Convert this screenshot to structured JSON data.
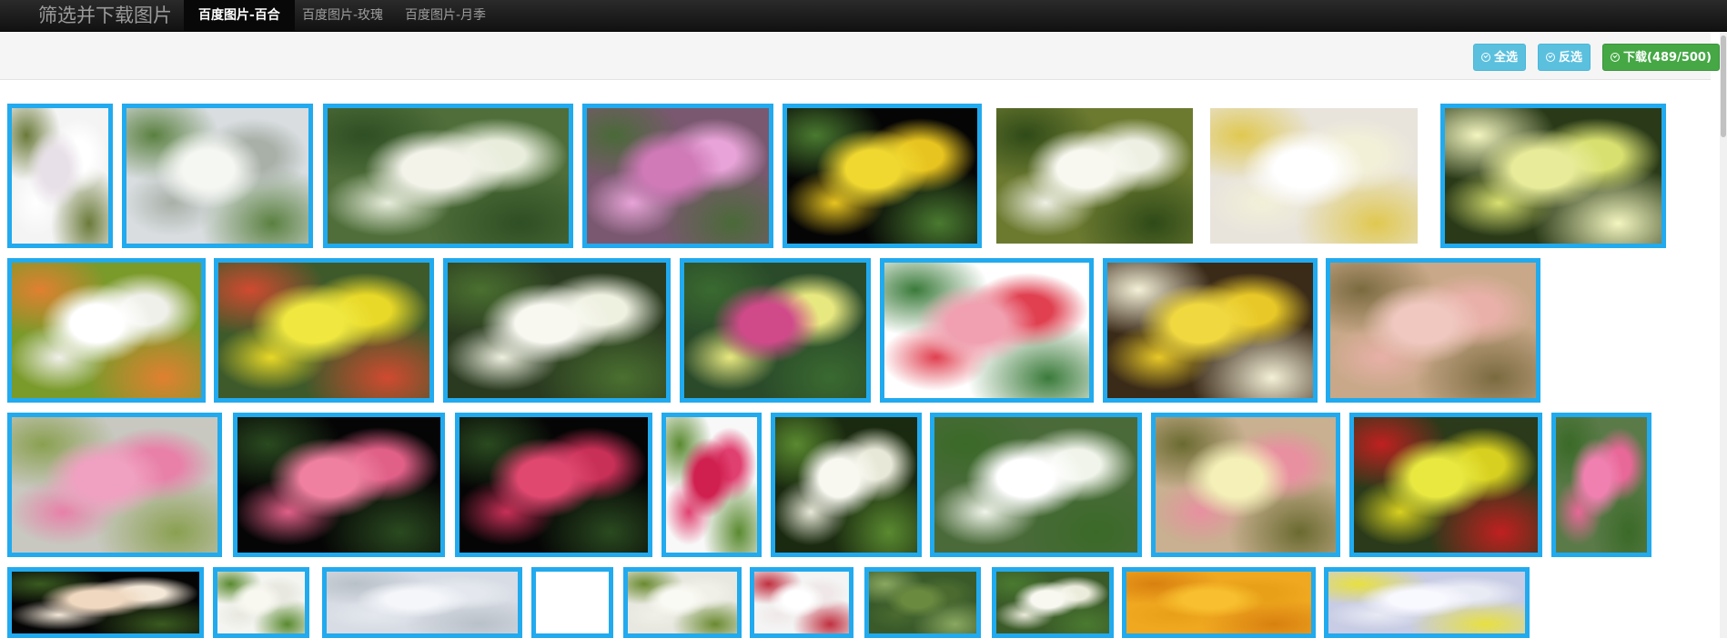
{
  "app": {
    "brand": "筛选并下载图片",
    "tabs": [
      {
        "label": "百度图片-百合",
        "active": true
      },
      {
        "label": "百度图片-玫瑰",
        "active": false
      },
      {
        "label": "百度图片-月季",
        "active": false
      }
    ]
  },
  "toolbar": {
    "select_all": "全选",
    "invert": "反选",
    "download": "下载(489/500)"
  },
  "colors": {
    "selected_border": "#22aaee",
    "btn_info": "#5bc0de",
    "btn_success": "#45a845"
  },
  "gallery": {
    "images": [
      {
        "bg": "#f4f4f4",
        "a": "#e8e0e8",
        "b": "#ffffff",
        "c": "#6b7a3a",
        "selected": true
      },
      {
        "bg": "#d9dde0",
        "a": "#f5f7f2",
        "b": "#a8b0a8",
        "c": "#5a8040",
        "selected": true
      },
      {
        "bg": "#4f6e3a",
        "a": "#f3f3ea",
        "b": "#e8eddc",
        "c": "#2f4f24",
        "selected": true
      },
      {
        "bg": "#7a5870",
        "a": "#d07ab8",
        "b": "#e8a4d8",
        "c": "#4a6a38",
        "selected": true
      },
      {
        "bg": "#050505",
        "a": "#f0d830",
        "b": "#e8c420",
        "c": "#4a7a30",
        "selected": true
      },
      {
        "bg": "#6c7a30",
        "a": "#f8f8f0",
        "b": "#eef0e4",
        "c": "#2f4a18",
        "selected": false
      },
      {
        "bg": "#e8e4dc",
        "a": "#ffffff",
        "b": "#f3f0d8",
        "c": "#e0c850",
        "selected": false
      },
      {
        "bg": "#2a3a18",
        "a": "#e8ec9a",
        "b": "#d8e070",
        "c": "#f4f6c0",
        "selected": true
      },
      {
        "bg": "#7a9a2a",
        "a": "#ffffff",
        "b": "#f0f0ea",
        "c": "#e08030",
        "selected": true
      },
      {
        "bg": "#3e5a2a",
        "a": "#f0e840",
        "b": "#e8d828",
        "c": "#d04a30",
        "selected": true
      },
      {
        "bg": "#2a3a20",
        "a": "#f8f8f0",
        "b": "#eef0e0",
        "c": "#4a7030",
        "selected": true
      },
      {
        "bg": "#2a4a2a",
        "a": "#d04a8a",
        "b": "#e8e880",
        "c": "#3a6a30",
        "selected": true
      },
      {
        "bg": "#ffffff",
        "a": "#f0a0b0",
        "b": "#e04050",
        "c": "#3a7a3a",
        "selected": true
      },
      {
        "bg": "#3a2a18",
        "a": "#f0d840",
        "b": "#e8c828",
        "c": "#f4f0d8",
        "selected": true
      },
      {
        "bg": "#c8a888",
        "a": "#f0c8c0",
        "b": "#e8b0a8",
        "c": "#7a6a40",
        "selected": true
      },
      {
        "bg": "#c8c8c0",
        "a": "#f0a0c0",
        "b": "#e880a8",
        "c": "#8aa050",
        "selected": true
      },
      {
        "bg": "#050505",
        "a": "#f080a0",
        "b": "#e06088",
        "c": "#2a4a20",
        "selected": true
      },
      {
        "bg": "#050505",
        "a": "#e04870",
        "b": "#c83058",
        "c": "#2a4a20",
        "selected": true
      },
      {
        "bg": "#f8f8f8",
        "a": "#d02050",
        "b": "#e04070",
        "c": "#5a8a30",
        "selected": true
      },
      {
        "bg": "#1a2a10",
        "a": "#f8f8f0",
        "b": "#e8e8d8",
        "c": "#5a8a30",
        "selected": true
      },
      {
        "bg": "#4a6a3a",
        "a": "#ffffff",
        "b": "#f0f4ea",
        "c": "#3a6a28",
        "selected": true
      },
      {
        "bg": "#c8b090",
        "a": "#f4f0b8",
        "b": "#e890a0",
        "c": "#6a6a30",
        "selected": true
      },
      {
        "bg": "#2a3a1a",
        "a": "#e8e840",
        "b": "#d8d020",
        "c": "#c02020",
        "selected": true
      },
      {
        "bg": "#5a7a48",
        "a": "#f080b0",
        "b": "#e86898",
        "c": "#3a6a28",
        "selected": true
      },
      {
        "bg": "#050505",
        "a": "#f0d8c0",
        "b": "#f4e8d8",
        "c": "#3a5a20",
        "selected": true
      },
      {
        "bg": "#f4f4f0",
        "a": "#f8f8f0",
        "b": "#e8e8e0",
        "c": "#5a8a30",
        "selected": true
      },
      {
        "bg": "#d8dce4",
        "a": "#f4f6fa",
        "b": "#e4e8ee",
        "c": "#b8c0c8",
        "selected": true
      },
      {
        "bg": "#ffffff",
        "a": "#ffffff",
        "b": "#ffffff",
        "c": "#ffffff",
        "selected": true
      },
      {
        "bg": "#e8e8e0",
        "a": "#fafaf4",
        "b": "#f0f0e8",
        "c": "#6a8a30",
        "selected": true
      },
      {
        "bg": "#f4f4f4",
        "a": "#ffffff",
        "b": "#f0e8e8",
        "c": "#c03040",
        "selected": true
      },
      {
        "bg": "#3a5a2a",
        "a": "#6a8a40",
        "b": "#4a6a30",
        "c": "#8aa860",
        "selected": true
      },
      {
        "bg": "#3a5a28",
        "a": "#f8f8f0",
        "b": "#ececdc",
        "c": "#4a7a30",
        "selected": true
      },
      {
        "bg": "#f0a820",
        "a": "#f8c030",
        "b": "#e8a018",
        "c": "#d88010",
        "selected": true
      },
      {
        "bg": "#c8cce4",
        "a": "#f8f8ff",
        "b": "#e8eaf4",
        "c": "#e8e040",
        "selected": true
      }
    ]
  }
}
